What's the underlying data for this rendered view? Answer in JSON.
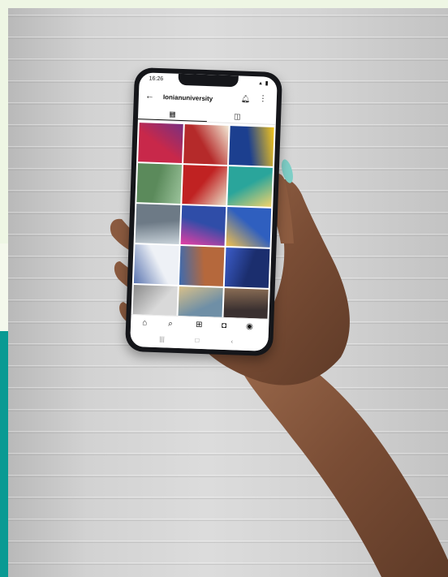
{
  "phone": {
    "status_time": "16:26",
    "status_icons": "▴ ▮",
    "profile_name": "Ionianuniversity",
    "icons": {
      "back": "back-arrow-icon",
      "bell": "bell-icon",
      "more": "more-icon",
      "grid_tab": "grid-icon",
      "tagged_tab": "tagged-icon",
      "home": "home-icon",
      "search": "search-icon",
      "add": "add-icon",
      "shop": "shop-icon",
      "profile": "profile-icon"
    },
    "tile_colors": [
      [
        "#c8284a",
        "#7a3080"
      ],
      [
        "#b52a2a",
        "#f2e9d5"
      ],
      [
        "#1c3f8f",
        "#f3c51c"
      ],
      [
        "#5b8a5b",
        "#9ac29a"
      ],
      [
        "#c02222",
        "#e8e0c9"
      ],
      [
        "#2aa59b",
        "#f3d36b"
      ],
      [
        "#6d7a86",
        "#c9d3da"
      ],
      [
        "#2f4da8",
        "#e43fa3"
      ],
      [
        "#2f5fbf",
        "#f2c04c"
      ],
      [
        "#eef1f6",
        "#5a74b0"
      ],
      [
        "#b5683c",
        "#3d6bb0"
      ],
      [
        "#1b2e6e",
        "#3b5cc9"
      ],
      [
        "#d9d9d9",
        "#8a8a8a"
      ],
      [
        "#6f8fa6",
        "#d8c08a"
      ],
      [
        "#3a3030",
        "#8a6d55"
      ]
    ]
  }
}
